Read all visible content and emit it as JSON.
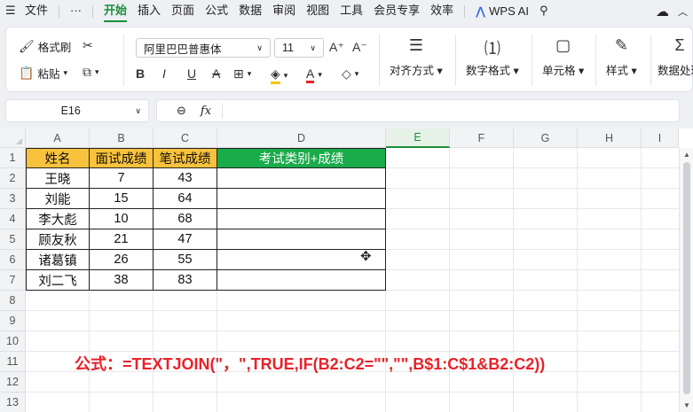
{
  "menu": {
    "file": "文件",
    "more": "···",
    "tabs": [
      "开始",
      "插入",
      "页面",
      "公式",
      "数据",
      "审阅",
      "视图",
      "工具",
      "会员专享",
      "效率"
    ],
    "active_tab": "开始",
    "wps_ai": "WPS AI"
  },
  "ribbon": {
    "format_painter": "格式刷",
    "paste": "粘贴",
    "font_name": "阿里巴巴普惠体",
    "font_size": "11",
    "align": "对齐方式",
    "number_format": "数字格式",
    "cell": "单元格",
    "style": "样式",
    "data_process": "数据处理"
  },
  "formula_bar": {
    "cell_ref": "E16",
    "fx": "fx",
    "content": ""
  },
  "grid": {
    "columns": [
      "A",
      "B",
      "C",
      "D",
      "E",
      "F",
      "G",
      "H",
      "I"
    ],
    "selected_column": "E",
    "rows": [
      "1",
      "2",
      "3",
      "4",
      "5",
      "6",
      "7",
      "8",
      "9",
      "10",
      "11",
      "12",
      "13"
    ],
    "table": {
      "headers": [
        "姓名",
        "面试成绩",
        "笔试成绩",
        "考试类别+成绩"
      ],
      "rows": [
        [
          "王晓",
          "7",
          "43",
          ""
        ],
        [
          "刘能",
          "15",
          "64",
          ""
        ],
        [
          "李大彪",
          "10",
          "68",
          ""
        ],
        [
          "顾友秋",
          "21",
          "47",
          ""
        ],
        [
          "诸葛镇",
          "26",
          "55",
          ""
        ],
        [
          "刘二飞",
          "38",
          "83",
          ""
        ]
      ]
    },
    "note": "公式：=TEXTJOIN(\"，\",TRUE,IF(B2:C2=\"\",\"\",B$1:C$1&B2:C2))"
  },
  "colors": {
    "accent": "#1a8f3a",
    "header_yellow": "#f9c23c",
    "header_green": "#1aab4b",
    "note_red": "#e8232a"
  }
}
